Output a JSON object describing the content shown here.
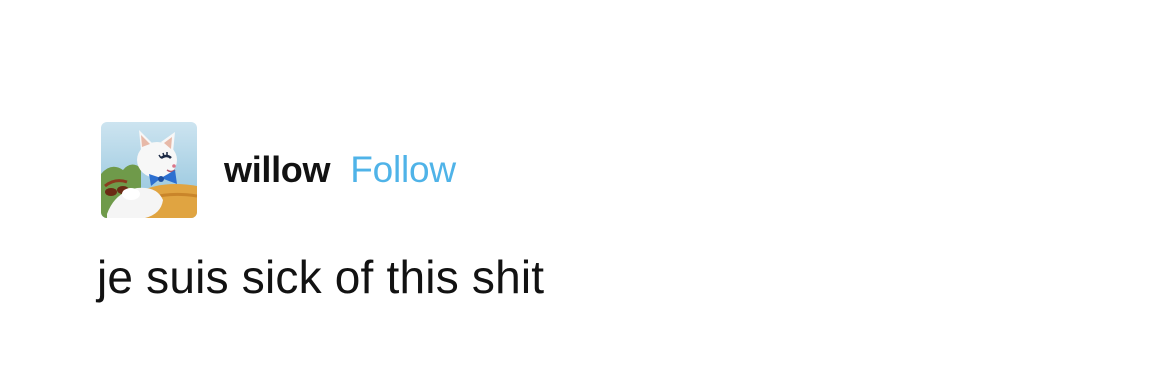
{
  "post": {
    "author": {
      "username": "willow",
      "avatar_icon": "cartoon-cat-avatar-icon"
    },
    "follow_label": "Follow",
    "text": "je suis sick of this shit"
  },
  "colors": {
    "follow_link": "#4fb3e8",
    "text": "#121212",
    "background": "#ffffff"
  }
}
